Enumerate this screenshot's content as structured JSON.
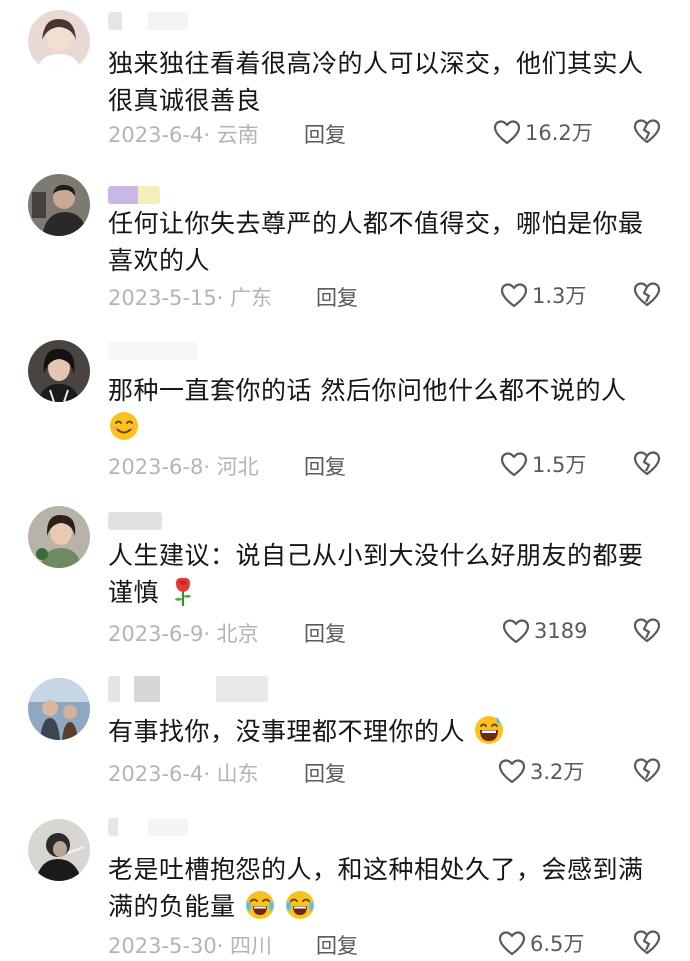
{
  "comments": [
    {
      "text": "独来独往看着很高冷的人可以深交，他们其实人很真诚很善良",
      "date": "2023-6-4· 云南",
      "reply": "回复",
      "likes": "16.2万"
    },
    {
      "text": "任何让你失去尊严的人都不值得交，哪怕是你最喜欢的人",
      "date": "2023-5-15· 广东",
      "reply": "回复",
      "likes": "1.3万"
    },
    {
      "text": "那种一直套你的话 然后你问他什么都不说的人",
      "date": "2023-6-8· 河北",
      "reply": "回复",
      "likes": "1.5万"
    },
    {
      "text": "人生建议：说自己从小到大没什么好朋友的都要谨慎",
      "date": "2023-6-9· 北京",
      "reply": "回复",
      "likes": "3189"
    },
    {
      "text": "有事找你，没事理都不理你的人",
      "date": "2023-6-4· 山东",
      "reply": "回复",
      "likes": "3.2万"
    },
    {
      "text": "老是吐槽抱怨的人，和这种相处久了，会感到满满的负能量",
      "date": "2023-5-30· 四川",
      "reply": "回复",
      "likes": "6.5万"
    }
  ],
  "icons": {
    "like": "heart-outline-icon",
    "dislike": "broken-heart-icon"
  },
  "colors": {
    "text": "#161616",
    "meta": "#b4b4b4",
    "reply": "#5a5a5a",
    "icon": "#5a5a5a"
  }
}
